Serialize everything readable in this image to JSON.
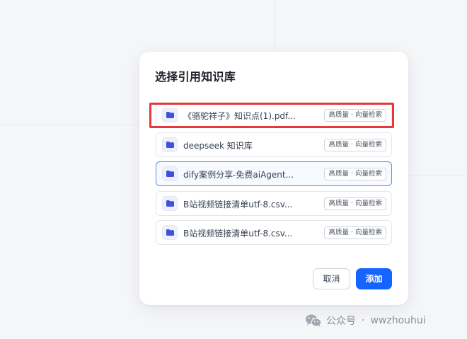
{
  "dialog": {
    "title": "选择引用知识库",
    "items": [
      {
        "name": "《骆驼祥子》知识点(1).pdf...",
        "badge": "高质量 · 向量检索",
        "icon": "folder-icon"
      },
      {
        "name": "deepseek 知识库",
        "badge": "高质量 · 向量检索",
        "icon": "folder-icon"
      },
      {
        "name": "dify案例分享-免费aiAgent...",
        "badge": "高质量 · 向量检索",
        "icon": "folder-icon"
      },
      {
        "name": "B站视频链接清单utf-8.csv...",
        "badge": "高质量 · 向量检索",
        "icon": "folder-icon"
      },
      {
        "name": "B站视频链接清单utf-8.csv...",
        "badge": "高质量 · 向量检索",
        "icon": "folder-icon"
      }
    ],
    "buttons": {
      "cancel": "取消",
      "add": "添加"
    }
  },
  "watermark": {
    "account": "公众号",
    "separator": "·",
    "handle": "wwzhouhui",
    "icon": "wechat-icon"
  },
  "colors": {
    "primary": "#1664ff",
    "highlight": "#e63a3a",
    "folder": "#3f51d9",
    "hover_border": "#5b8cf0"
  }
}
